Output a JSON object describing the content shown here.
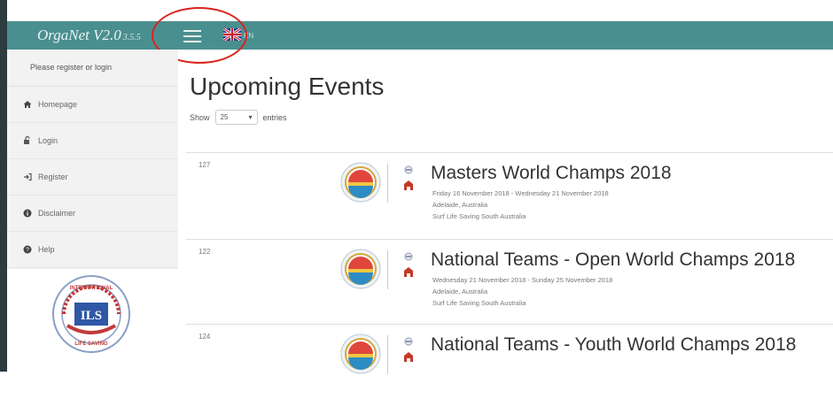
{
  "header": {
    "brand": "OrgaNet V2.0",
    "brand_version": "3.5.5",
    "language": "EN"
  },
  "sidebar": {
    "notice": "Please register or login",
    "items": [
      {
        "label": "Homepage",
        "icon": "home-icon"
      },
      {
        "label": "Login",
        "icon": "login-icon"
      },
      {
        "label": "Register",
        "icon": "register-icon"
      },
      {
        "label": "Disclaimer",
        "icon": "info-icon"
      },
      {
        "label": "Help",
        "icon": "help-icon"
      }
    ],
    "logo_text": {
      "top": "INTERNATIONAL",
      "mid": "ILS",
      "bottom": "LIFE SAVING"
    }
  },
  "main": {
    "title": "Upcoming Events",
    "show_label": "Show",
    "page_size": "25",
    "entries_label": "entries",
    "events": [
      {
        "id": "127",
        "title": "Masters World Champs 2018",
        "dates": "Friday 16 November 2018 - Wednesday 21 November 2018",
        "location": "Adelaide, Australia",
        "organizer": "Surf Life Saving South Australia"
      },
      {
        "id": "122",
        "title": "National Teams - Open World Champs 2018",
        "dates": "Wednesday 21 November 2018 - Sunday 25 November 2018",
        "location": "Adelaide, Australia",
        "organizer": "Surf Life Saving South Australia"
      },
      {
        "id": "124",
        "title": "National Teams - Youth World Champs 2018",
        "dates": "",
        "location": "",
        "organizer": ""
      }
    ]
  },
  "colors": {
    "topbar": "#4a8f8f",
    "sidebar": "#f2f2f2",
    "annotation": "#d9241c"
  }
}
